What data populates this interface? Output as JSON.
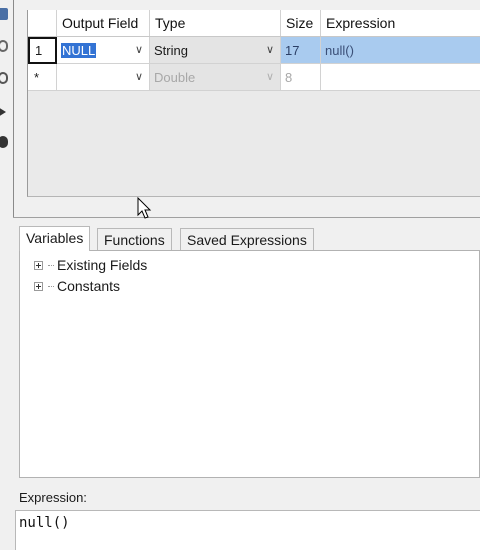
{
  "grid": {
    "columns": [
      "Output Field",
      "Type",
      "Size",
      "Expression"
    ],
    "rows": [
      {
        "row_header": "1",
        "output_field": "NULL",
        "type": "String",
        "size": "17",
        "expression": "null()",
        "selected": true
      },
      {
        "row_header": "*",
        "output_field": "",
        "type": "Double",
        "size": "8",
        "expression": "",
        "selected": false
      }
    ]
  },
  "tabs": {
    "items": [
      "Variables",
      "Functions",
      "Saved Expressions"
    ],
    "active": "Variables"
  },
  "tree": {
    "items": [
      "Existing Fields",
      "Constants"
    ]
  },
  "expression": {
    "label": "Expression:",
    "value": "null()"
  },
  "icons": {
    "combo_arrow": "chevron-down-icon",
    "tree_expand": "plus-box-icon",
    "cursor": "arrow-cursor-icon"
  },
  "colors": {
    "selection_blue": "#3373d4",
    "selected_row": "#a9cbef",
    "grid_bg": "#eaeaea"
  }
}
